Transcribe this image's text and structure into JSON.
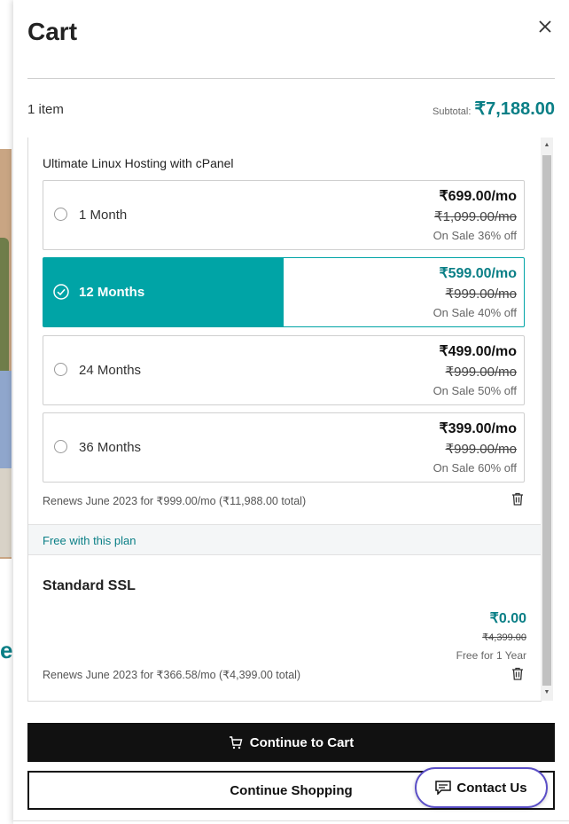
{
  "cart": {
    "title": "Cart",
    "item_count": "1 item",
    "subtotal_label": "Subtotal:",
    "subtotal_value": "₹7,188.00"
  },
  "product": {
    "name": "Ultimate Linux Hosting with cPanel",
    "options": [
      {
        "term": "1 Month",
        "price_now": "₹699.00/mo",
        "price_was": "₹1,099.00/mo",
        "sale": "On Sale 36% off",
        "selected": false
      },
      {
        "term": "12 Months",
        "price_now": "₹599.00/mo",
        "price_was": "₹999.00/mo",
        "sale": "On Sale 40% off",
        "selected": true
      },
      {
        "term": "24 Months",
        "price_now": "₹499.00/mo",
        "price_was": "₹999.00/mo",
        "sale": "On Sale 50% off",
        "selected": false
      },
      {
        "term": "36 Months",
        "price_now": "₹399.00/mo",
        "price_was": "₹999.00/mo",
        "sale": "On Sale 60% off",
        "selected": false
      }
    ],
    "renews": "Renews June 2023 for ₹999.00/mo (₹11,988.00 total)"
  },
  "free_with_plan": "Free with this plan",
  "ssl": {
    "name": "Standard SSL",
    "price_now": "₹0.00",
    "price_was": "₹4,399.00",
    "free_note": "Free for 1 Year",
    "renews": "Renews June 2023 for ₹366.58/mo (₹4,399.00 total)"
  },
  "buttons": {
    "continue_to_cart": "Continue to Cart",
    "continue_shopping": "Continue Shopping",
    "contact_us": "Contact Us"
  },
  "colors": {
    "accent_teal": "#00a4a6",
    "price_teal": "#0a7f86",
    "contact_border": "#5b4fc7"
  },
  "icons": [
    "close-icon",
    "check-circle-icon",
    "trash-icon",
    "cart-icon",
    "chat-icon"
  ]
}
